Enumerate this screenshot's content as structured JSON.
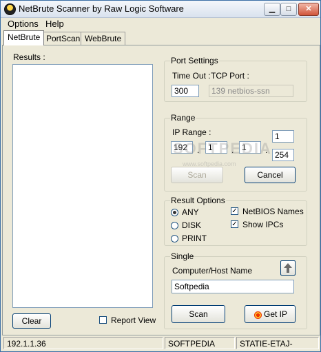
{
  "window": {
    "title": "NetBrute Scanner by Raw Logic Software"
  },
  "menu": [
    "Options",
    "Help"
  ],
  "tabs": [
    "NetBrute",
    "PortScan",
    "WebBrute"
  ],
  "results": {
    "label": "Results :",
    "clear_label": "Clear",
    "report_view_label": "Report View"
  },
  "port_settings": {
    "title": "Port Settings",
    "timeout_label": "Time Out :",
    "tcp_port_label": "TCP Port :",
    "timeout_value": "300",
    "tcp_port_value": "139     netbios-ssn"
  },
  "range": {
    "title": "Range",
    "ip_range_label": "IP Range :",
    "octets": [
      "192",
      "1",
      "1"
    ],
    "start": "1",
    "end": "254",
    "dot": ".",
    "scan_label": "Scan",
    "cancel_label": "Cancel"
  },
  "result_options": {
    "title": "Result Options",
    "any": "ANY",
    "disk": "DISK",
    "print": "PRINT",
    "netbios_names": "NetBIOS Names",
    "show_ipcs": "Show IPCs",
    "check_mark": "✓"
  },
  "single": {
    "title": "Single",
    "host_label": "Computer/Host Name",
    "host_value": "Softpedia",
    "scan_label": "Scan",
    "getip_label": "Get IP"
  },
  "watermark": {
    "main": "SOFTPEDIA",
    "sub": "www.softpedia.com"
  },
  "status": [
    "192.1.1.36",
    "SOFTPEDIA",
    "STATIE-ETAJ-"
  ]
}
